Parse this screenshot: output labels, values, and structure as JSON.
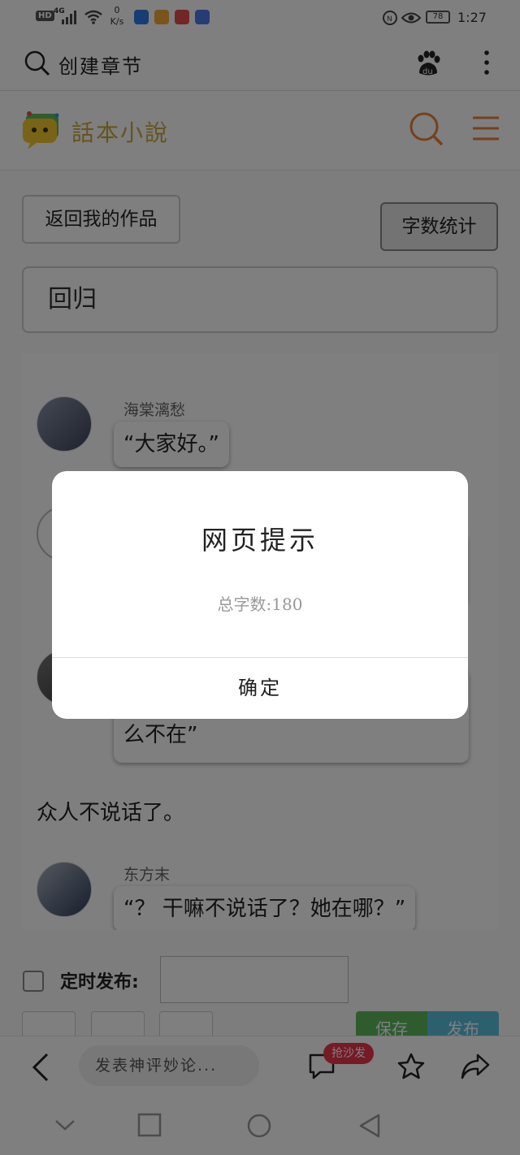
{
  "status_bar": {
    "hd": "HD",
    "network": "4G",
    "speed_value": "0",
    "speed_unit": "K/s",
    "battery": "78",
    "time": "1:27"
  },
  "browser_bar": {
    "title": "创建章节"
  },
  "site_header": {
    "logo_text": "話本小說",
    "accent_color": "#e8823b"
  },
  "page": {
    "back_button": "返回我的作品",
    "word_count_button": "字数统计",
    "chapter_title": "回归",
    "messages": [
      {
        "speaker": "海棠漓愁",
        "text": "“大家好。”"
      },
      {
        "text": "么不在”"
      },
      {
        "narration": "众人不说话了。"
      },
      {
        "speaker": "东方末",
        "text": "“？ 干嘛不说话了？她在哪？”"
      }
    ],
    "schedule_label": "定时发布:",
    "save_button": "保存",
    "publish_button": "发布"
  },
  "bottom_bar": {
    "comment_placeholder": "发表神评妙论...",
    "badge": "抢沙发"
  },
  "dialog": {
    "title": "网页提示",
    "message": "总字数:180",
    "ok_button": "确定"
  }
}
